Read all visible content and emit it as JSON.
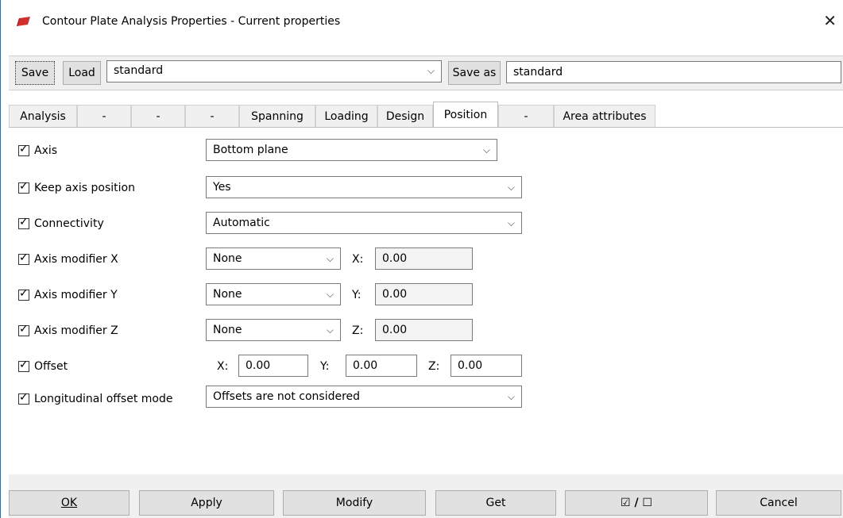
{
  "window": {
    "title": "Contour Plate Analysis Properties - Current properties"
  },
  "topbar": {
    "save_label": "Save",
    "load_label": "Load",
    "preset_value": "standard",
    "save_as_label": "Save as",
    "save_as_value": "standard"
  },
  "tabs": [
    {
      "label": "Analysis"
    },
    {
      "label": "-"
    },
    {
      "label": "-"
    },
    {
      "label": "-"
    },
    {
      "label": "Spanning"
    },
    {
      "label": "Loading"
    },
    {
      "label": "Design"
    },
    {
      "label": "Position"
    },
    {
      "label": "-"
    },
    {
      "label": "Area attributes"
    }
  ],
  "rows": {
    "axis": {
      "label": "Axis",
      "value": "Bottom plane"
    },
    "keep_axis": {
      "label": "Keep axis position",
      "value": "Yes"
    },
    "connectivity": {
      "label": "Connectivity",
      "value": "Automatic"
    },
    "mod_x": {
      "label": "Axis modifier X",
      "value": "None",
      "coord_label": "X:",
      "coord_value": "0.00"
    },
    "mod_y": {
      "label": "Axis modifier Y",
      "value": "None",
      "coord_label": "Y:",
      "coord_value": "0.00"
    },
    "mod_z": {
      "label": "Axis modifier Z",
      "value": "None",
      "coord_label": "Z:",
      "coord_value": "0.00"
    },
    "offset": {
      "label": "Offset",
      "x_label": "X:",
      "x_value": "0.00",
      "y_label": "Y:",
      "y_value": "0.00",
      "z_label": "Z:",
      "z_value": "0.00"
    },
    "long_offset": {
      "label": "Longitudinal offset mode",
      "value": "Offsets are not considered"
    }
  },
  "bottom": {
    "ok_label": "OK",
    "apply_label": "Apply",
    "modify_label": "Modify",
    "get_label": "Get",
    "toggle_label": "☑ / ☐",
    "cancel_label": "Cancel"
  },
  "colors": {
    "accent": "#1a6fc9",
    "app_icon": "#d32f2f"
  }
}
